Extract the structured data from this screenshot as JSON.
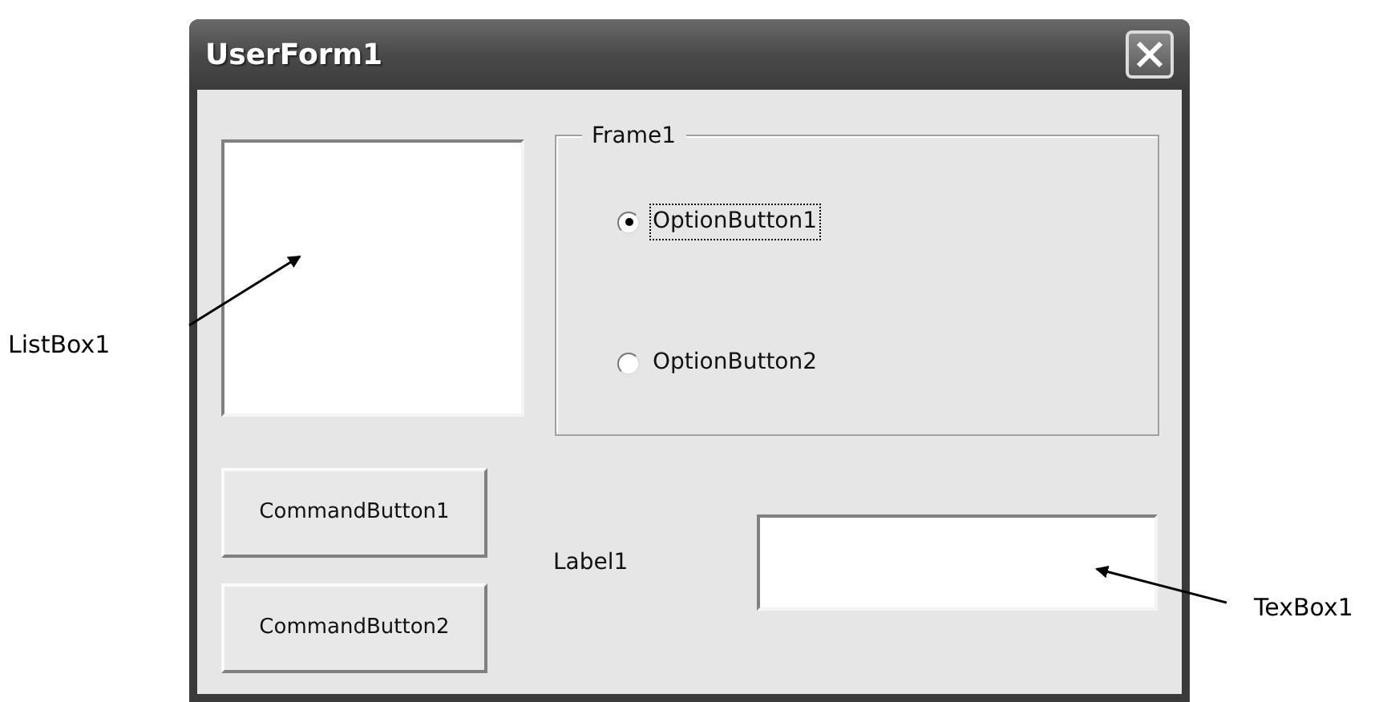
{
  "window": {
    "title": "UserForm1"
  },
  "frame": {
    "caption": "Frame1",
    "options": [
      {
        "label": "OptionButton1",
        "selected": true
      },
      {
        "label": "OptionButton2",
        "selected": false
      }
    ]
  },
  "buttons": [
    "CommandButton1",
    "CommandButton2"
  ],
  "label": "Label1",
  "annotations": [
    {
      "text": "ListBox1",
      "kind": "listbox"
    },
    {
      "text": "TexBox1",
      "kind": "textbox"
    }
  ]
}
